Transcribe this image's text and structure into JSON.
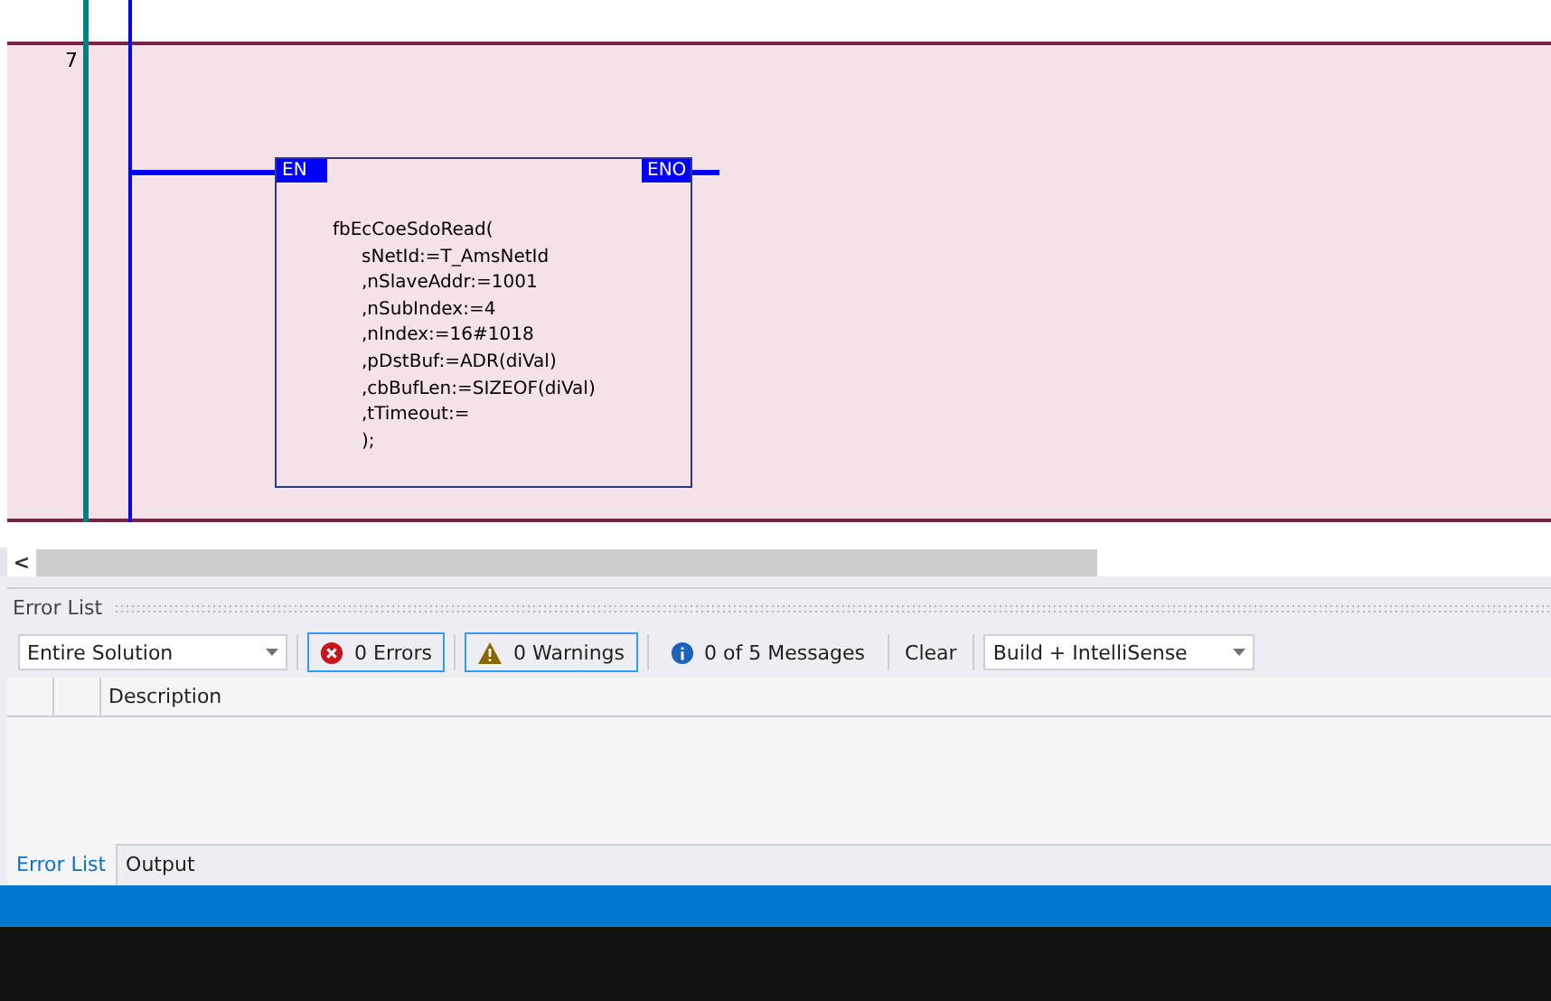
{
  "editor": {
    "rung": {
      "number": "7",
      "block": {
        "en": "EN",
        "eno": "ENO",
        "call": "fbEcCoeSdoRead(",
        "lines": [
          "sNetId:=T_AmsNetId",
          ",nSlaveAddr:=1001",
          ",nSubIndex:=4",
          ",nIndex:=16#1018",
          ",pDstBuf:=ADR(diVal)",
          ",cbBufLen:=SIZEOF(diVal)",
          ",tTimeout:=",
          ");"
        ]
      }
    },
    "scroll_arrow": "<"
  },
  "error_list": {
    "title": "Error List",
    "scope": "Entire Solution",
    "filters": [
      {
        "kind": "error",
        "label": "0 Errors",
        "selected": true
      },
      {
        "kind": "warning",
        "label": "0 Warnings",
        "selected": true
      },
      {
        "kind": "message",
        "label": "0 of 5 Messages",
        "selected": false
      }
    ],
    "clear": "Clear",
    "source": "Build + IntelliSense",
    "columns": [
      "Description"
    ]
  },
  "tabs": [
    {
      "label": "Error List",
      "selected": true
    },
    {
      "label": "Output",
      "selected": false
    }
  ]
}
